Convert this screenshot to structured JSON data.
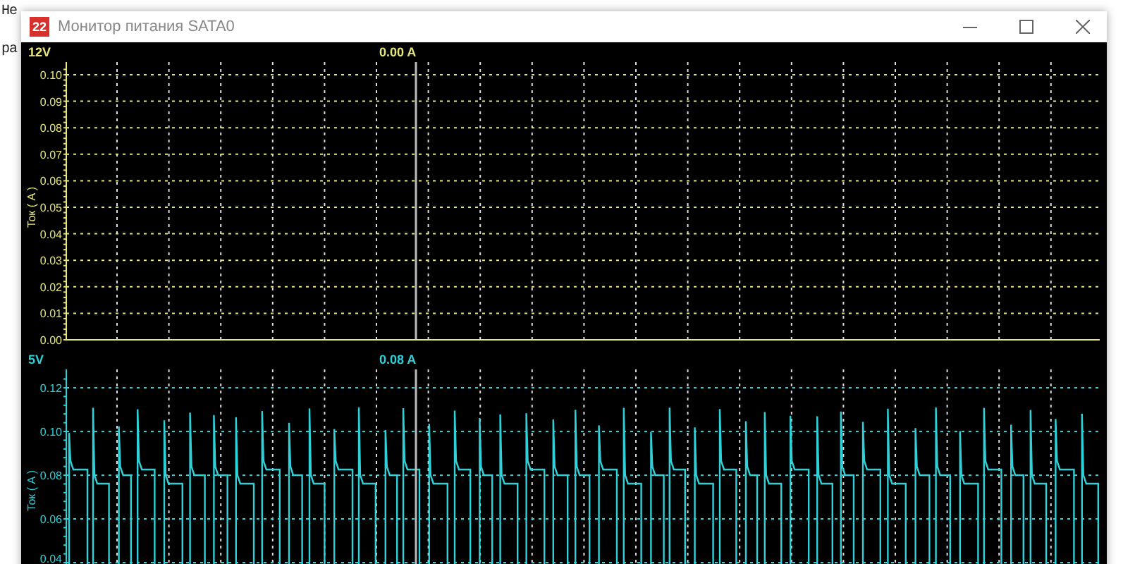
{
  "background": {
    "lines": [
      "Не",
      "ра"
    ]
  },
  "window": {
    "title": "Монитор питания SATA0",
    "app_icon": "22"
  },
  "panels": [
    {
      "kind": "flat",
      "rail": "12V",
      "reading": "0.00 A",
      "ylabel": "Ток ( A )",
      "color": "#e6e67a",
      "yticks": [
        "0.10",
        "0.09",
        "0.08",
        "0.07",
        "0.06",
        "0.05",
        "0.04",
        "0.03",
        "0.02",
        "0.01",
        "0.00"
      ]
    },
    {
      "kind": "waveform",
      "rail": "5V",
      "reading": "0.08 A",
      "ylabel": "Ток ( A )",
      "color": "#2fd0d8",
      "yticks": [
        "0.12",
        "0.10",
        "0.08",
        "0.06",
        "0.04"
      ]
    }
  ]
}
